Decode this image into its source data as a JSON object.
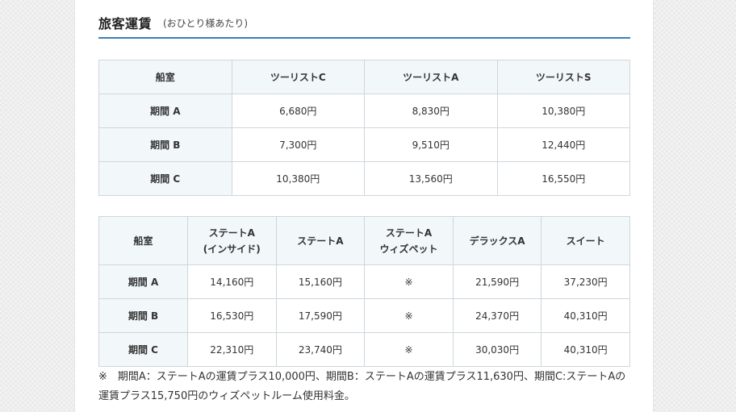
{
  "heading": {
    "title": "旅客運賃",
    "note": "(おひとり様あたり)"
  },
  "table1": {
    "headers": [
      "船室",
      "ツーリストC",
      "ツーリストA",
      "ツーリストS"
    ],
    "rows": [
      {
        "period": "期間 A",
        "values": [
          "6,680円",
          "8,830円",
          "10,380円"
        ]
      },
      {
        "period": "期間 B",
        "values": [
          "7,300円",
          "9,510円",
          "12,440円"
        ]
      },
      {
        "period": "期間 C",
        "values": [
          "10,380円",
          "13,560円",
          "16,550円"
        ]
      }
    ]
  },
  "table2": {
    "headers": [
      {
        "line1": "船室",
        "line2": ""
      },
      {
        "line1": "ステートA",
        "line2": "(インサイド)"
      },
      {
        "line1": "ステートA",
        "line2": ""
      },
      {
        "line1": "ステートA",
        "line2": "ウィズペット"
      },
      {
        "line1": "デラックスA",
        "line2": ""
      },
      {
        "line1": "スイート",
        "line2": ""
      }
    ],
    "rows": [
      {
        "period": "期間 A",
        "values": [
          "14,160円",
          "15,160円",
          "※",
          "21,590円",
          "37,230円"
        ]
      },
      {
        "period": "期間 B",
        "values": [
          "16,530円",
          "17,590円",
          "※",
          "24,370円",
          "40,310円"
        ]
      },
      {
        "period": "期間 C",
        "values": [
          "22,310円",
          "23,740円",
          "※",
          "30,030円",
          "40,310円"
        ]
      }
    ]
  },
  "footnote": "※　期間A：ステートAの運賃プラス10,000円、期間B：ステートAの運賃プラス11,630円、期間C:ステートAの運賃プラス15,750円のウィズペットルーム使用料金。"
}
